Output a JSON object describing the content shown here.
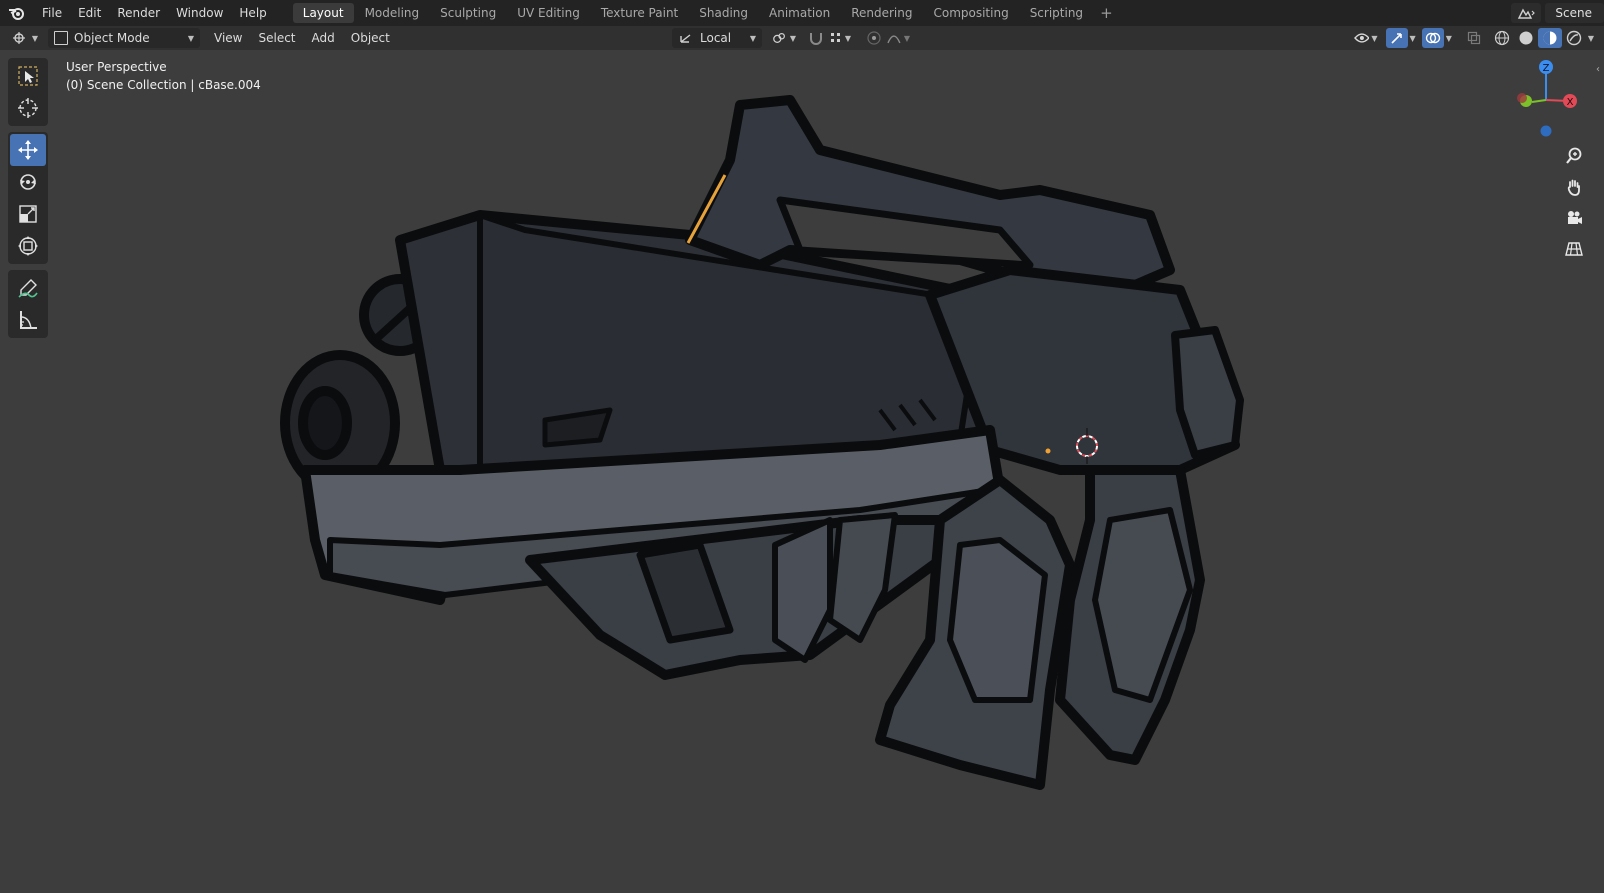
{
  "menu": [
    "File",
    "Edit",
    "Render",
    "Window",
    "Help"
  ],
  "workspaces": [
    {
      "label": "Layout",
      "active": true
    },
    {
      "label": "Modeling",
      "active": false
    },
    {
      "label": "Sculpting",
      "active": false
    },
    {
      "label": "UV Editing",
      "active": false
    },
    {
      "label": "Texture Paint",
      "active": false
    },
    {
      "label": "Shading",
      "active": false
    },
    {
      "label": "Animation",
      "active": false
    },
    {
      "label": "Rendering",
      "active": false
    },
    {
      "label": "Compositing",
      "active": false
    },
    {
      "label": "Scripting",
      "active": false
    }
  ],
  "scene": {
    "name": "Scene"
  },
  "header": {
    "mode": "Object Mode",
    "menus": [
      "View",
      "Select",
      "Add",
      "Object"
    ],
    "orientation": "Local"
  },
  "viewport": {
    "perspective_label": "User Perspective",
    "collection_label": "(0) Scene Collection | cBase.004"
  },
  "gizmo": {
    "z": "Z",
    "x": "X"
  },
  "colors": {
    "accent": "#4772b3",
    "axis_x": "#e04b57",
    "axis_y": "#7dc12a",
    "axis_z": "#3b8ef0",
    "highlight_edge": "#e8a23a"
  },
  "icons": {
    "toolbar": [
      "select-box-icon",
      "cursor-icon",
      "move-icon",
      "rotate-icon",
      "scale-icon",
      "transform-icon",
      "annotate-icon",
      "measure-icon"
    ],
    "nav": [
      "zoom-icon",
      "hand-pan-icon",
      "camera-icon",
      "grid-ortho-icon"
    ]
  }
}
